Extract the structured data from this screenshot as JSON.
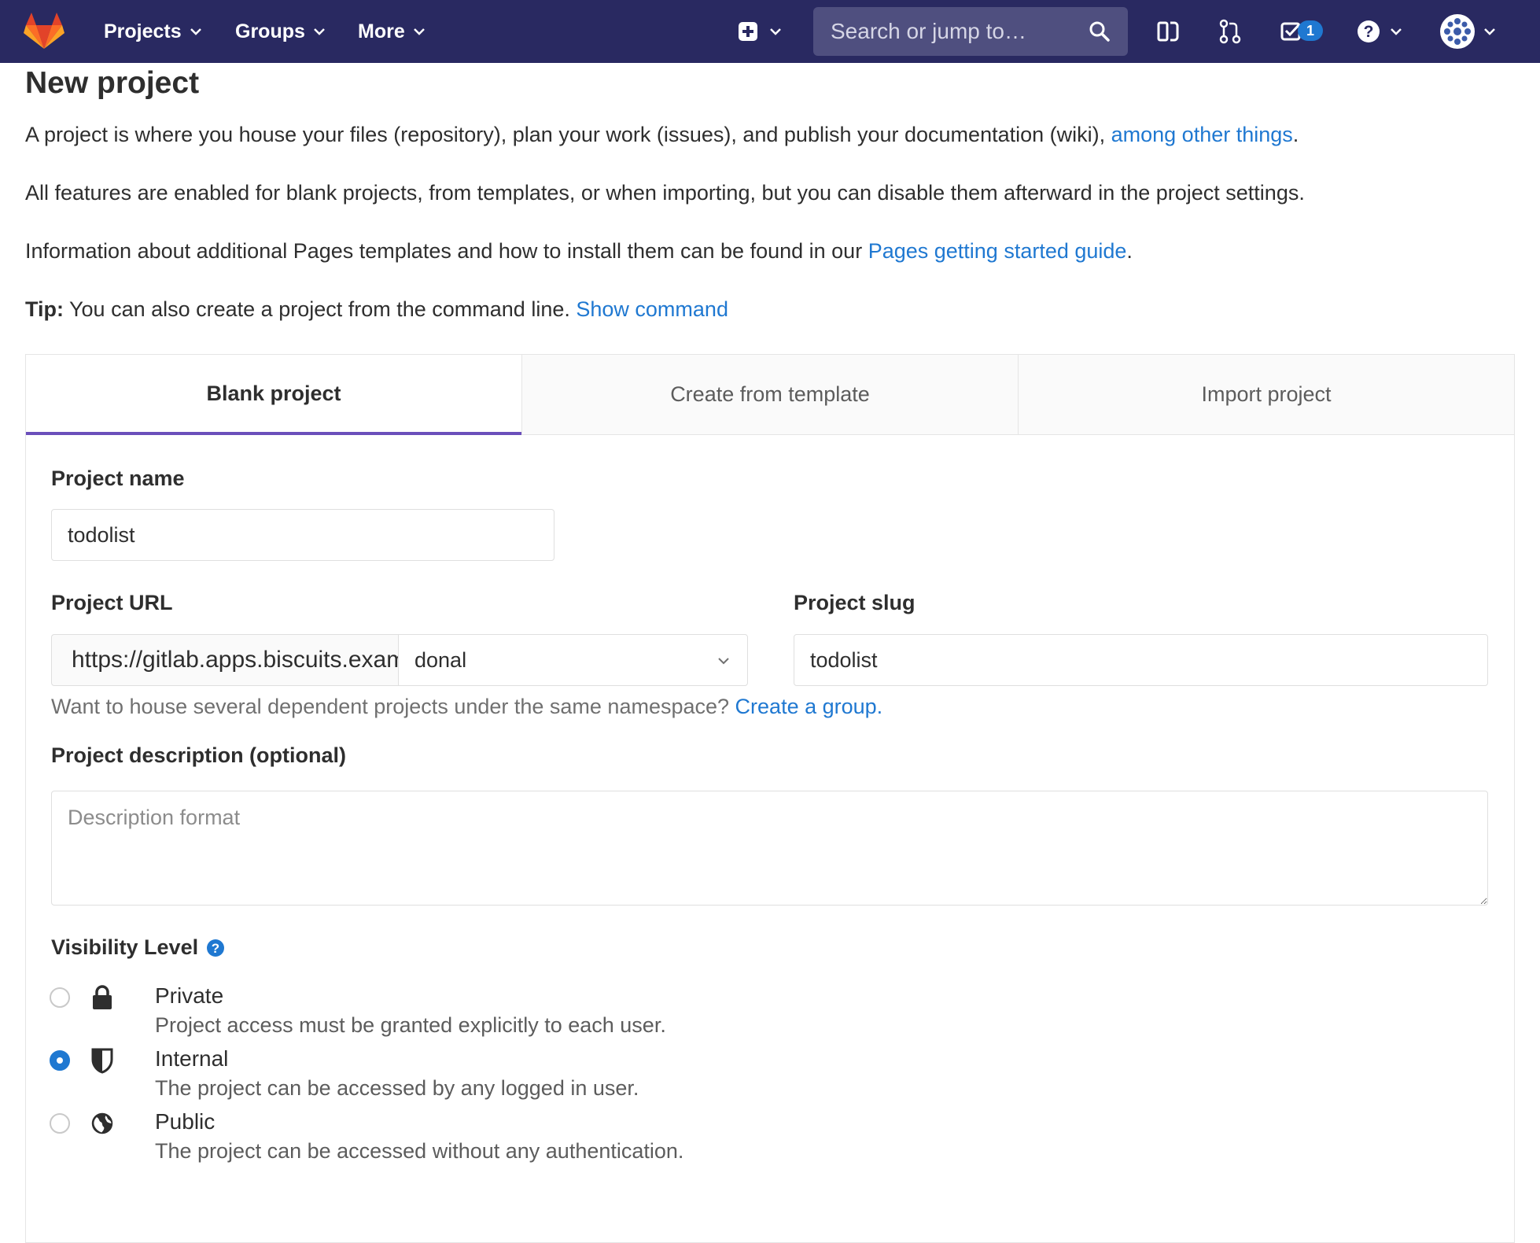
{
  "nav": {
    "items": [
      {
        "label": "Projects"
      },
      {
        "label": "Groups"
      },
      {
        "label": "More"
      }
    ],
    "search_placeholder": "Search or jump to…",
    "todo_count": "1"
  },
  "page": {
    "title": "New project",
    "intro": {
      "text": "A project is where you house your files (repository), plan your work (issues), and publish your documentation (wiki), ",
      "link": "among other things",
      "end": "."
    },
    "features_text": "All features are enabled for blank projects, from templates, or when importing, but you can disable them afterward in the project settings.",
    "pages_info": {
      "text": "Information about additional Pages templates and how to install them can be found in our ",
      "link": "Pages getting started guide",
      "end": "."
    },
    "tip": {
      "label": "Tip:",
      "text": " You can also create a project from the command line. ",
      "link": "Show command"
    }
  },
  "tabs": [
    {
      "label": "Blank project",
      "active": true
    },
    {
      "label": "Create from template",
      "active": false
    },
    {
      "label": "Import project",
      "active": false
    }
  ],
  "form": {
    "project_name_label": "Project name",
    "project_name_value": "todolist",
    "project_url_label": "Project URL",
    "project_url_prefix": "https://gitlab.apps.biscuits.example.com/",
    "namespace_value": "donal",
    "project_slug_label": "Project slug",
    "project_slug_value": "todolist",
    "group_help": {
      "text": "Want to house several dependent projects under the same namespace? ",
      "link": "Create a group."
    },
    "description_label": "Project description (optional)",
    "description_placeholder": "Description format",
    "visibility_label": "Visibility Level",
    "visibility_options": [
      {
        "label": "Private",
        "description": "Project access must be granted explicitly to each user.",
        "icon": "lock-icon",
        "checked": false
      },
      {
        "label": "Internal",
        "description": "The project can be accessed by any logged in user.",
        "icon": "shield-icon",
        "checked": true
      },
      {
        "label": "Public",
        "description": "The project can be accessed without any authentication.",
        "icon": "globe-icon",
        "checked": false
      }
    ]
  },
  "colors": {
    "navbar": "#292961",
    "link": "#1f78d1",
    "active_tab_border": "#6b4fbb"
  }
}
